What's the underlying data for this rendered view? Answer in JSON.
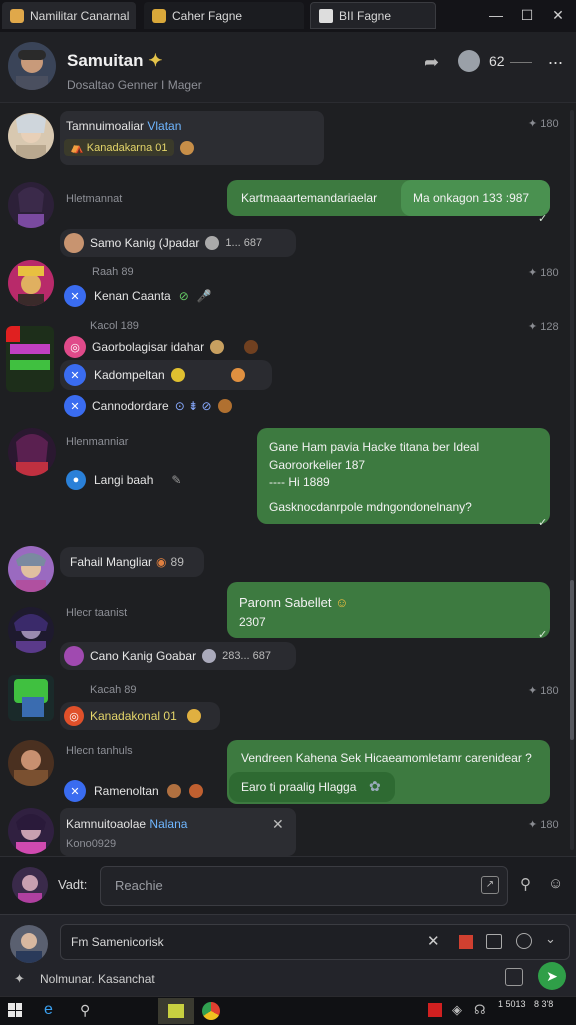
{
  "tabs": [
    {
      "label": "Namilitar Canarnal"
    },
    {
      "label": "Caher Fagne"
    },
    {
      "label": "BII Fagne"
    }
  ],
  "window_controls": {
    "minimize": "—",
    "maximize": "☐",
    "close": "✕"
  },
  "header": {
    "title": "Samuitan",
    "subtitle": "Dosaltao  Genner I Mager",
    "count": "62",
    "more": "..."
  },
  "messages": {
    "m1": {
      "title_a": "Tamnuimoaliar",
      "title_b": "Vlatan",
      "tag": "Kanadakarna 01",
      "time": "180"
    },
    "m2": {
      "author": "Hletmannat",
      "bubble_left": "Kartmaaartemandariaelar",
      "bubble_right": "Ma onkagon 133 :987"
    },
    "m3": {
      "text": "Samo Kanig (Jpadar",
      "tail": "1... 687"
    },
    "m4": {
      "author": "Raah 89",
      "text": "Kenan Caanta",
      "time": "180"
    },
    "m5": {
      "author": "Kacol 189",
      "row1": "Gaorbolagisar idahar",
      "row2": "Kadompeltan",
      "row3": "Cannodordare",
      "time": "128"
    },
    "m6": {
      "author": "Hlenmanniar",
      "line1": "Gane Ham pavia Hacke titana ber Ideal",
      "line2": "Gaoroorkelier 187",
      "line3": "---- Hi 1889",
      "line4": "Gasknocdanrpole mdngondonelnany?",
      "side_text": "Langi baah"
    },
    "m7": {
      "text": "Fahail Mangliar",
      "count": "89"
    },
    "m8": {
      "author": "Hlecr taanist",
      "bubble_l1": "Paronn Sabellet",
      "bubble_l2": "2307",
      "chip": "Cano Kanig Goabar",
      "chip_tail": "283... 687"
    },
    "m9": {
      "author": "Kacah 89",
      "tag": "Kanadakonal 01",
      "time": "180"
    },
    "m10": {
      "author": "Hlecn tanhuls",
      "bubble_l1": "Vendreen Kahena Sek Hicaeamomletamr carenidear ?",
      "bubble_l2": "Earo ti praalig Hlagga",
      "chip": "Ramenoltan"
    },
    "m11": {
      "title_a": "Kamnuitoaolae",
      "title_b": "Nalana",
      "sub": "Kono0929",
      "time": "180"
    }
  },
  "composer": {
    "label": "Vadt:",
    "placeholder": "Reachie"
  },
  "panel": {
    "input_text": "Fm Samenicorisk",
    "status": "Nolmunar. Kasanchat"
  },
  "taskbar": {
    "time": "1 5013",
    "date": "8 3'8"
  },
  "colors": {
    "accent_green": "#3d7a40",
    "background": "#1e1f22",
    "blue_badge": "#3a6cf0"
  }
}
